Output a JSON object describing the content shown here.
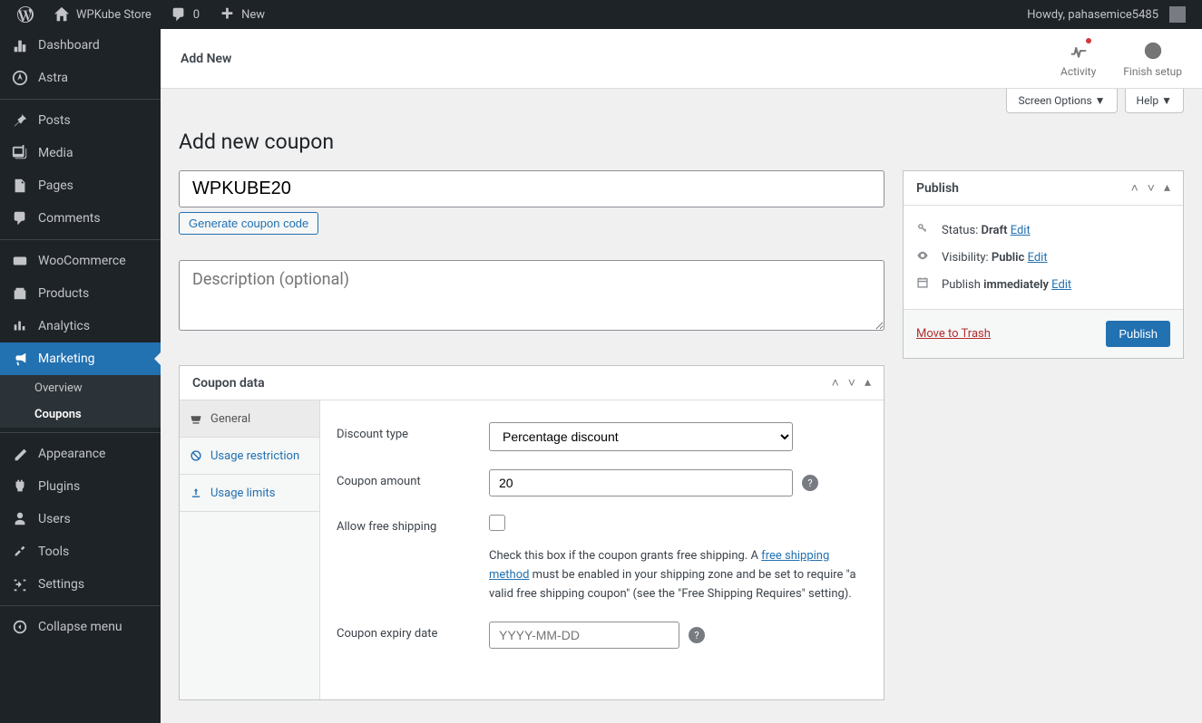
{
  "adminbar": {
    "site_name": "WPKube Store",
    "comment_count": "0",
    "new_label": "New",
    "howdy": "Howdy, pahasemice5485"
  },
  "topstrip": {
    "title": "Add New",
    "activity": "Activity",
    "finish_setup": "Finish setup"
  },
  "screen_options": "Screen Options",
  "help": "Help",
  "sidebar": {
    "dashboard": "Dashboard",
    "astra": "Astra",
    "posts": "Posts",
    "media": "Media",
    "pages": "Pages",
    "comments": "Comments",
    "woocommerce": "WooCommerce",
    "products": "Products",
    "analytics": "Analytics",
    "marketing": "Marketing",
    "overview": "Overview",
    "coupons": "Coupons",
    "appearance": "Appearance",
    "plugins": "Plugins",
    "users": "Users",
    "tools": "Tools",
    "settings": "Settings",
    "collapse": "Collapse menu"
  },
  "page": {
    "heading": "Add new coupon",
    "coupon_code": "WPKUBE20",
    "generate_btn": "Generate coupon code",
    "desc_placeholder": "Description (optional)"
  },
  "coupon_data": {
    "box_title": "Coupon data",
    "tabs": {
      "general": "General",
      "usage_restriction": "Usage restriction",
      "usage_limits": "Usage limits"
    },
    "fields": {
      "discount_type_label": "Discount type",
      "discount_type_value": "Percentage discount",
      "coupon_amount_label": "Coupon amount",
      "coupon_amount_value": "20",
      "free_shipping_label": "Allow free shipping",
      "free_shipping_text1": "Check this box if the coupon grants free shipping. A ",
      "free_shipping_link": "free shipping method",
      "free_shipping_text2": " must be enabled in your shipping zone and be set to require \"a valid free shipping coupon\" (see the \"Free Shipping Requires\" setting).",
      "expiry_label": "Coupon expiry date",
      "expiry_placeholder": "YYYY-MM-DD"
    }
  },
  "publish": {
    "box_title": "Publish",
    "status_label": "Status: ",
    "status_value": "Draft",
    "visibility_label": "Visibility: ",
    "visibility_value": "Public",
    "publish_label": "Publish ",
    "publish_value": "immediately",
    "edit": "Edit",
    "trash": "Move to Trash",
    "button": "Publish"
  }
}
